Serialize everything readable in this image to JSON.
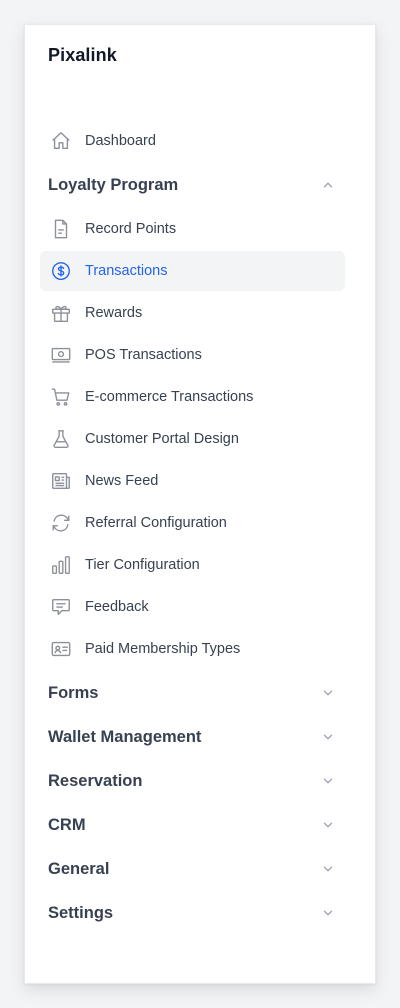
{
  "brand": "Pixalink",
  "nav": {
    "dashboard": "Dashboard",
    "loyalty_program": "Loyalty Program",
    "loyalty_items": [
      {
        "label": "Record Points",
        "icon": "document-icon"
      },
      {
        "label": "Transactions",
        "icon": "dollar-circle-icon",
        "active": true
      },
      {
        "label": "Rewards",
        "icon": "gift-icon"
      },
      {
        "label": "POS Transactions",
        "icon": "cash-icon"
      },
      {
        "label": "E-commerce Transactions",
        "icon": "cart-icon"
      },
      {
        "label": "Customer Portal Design",
        "icon": "beaker-icon"
      },
      {
        "label": "News Feed",
        "icon": "newspaper-icon"
      },
      {
        "label": "Referral Configuration",
        "icon": "refresh-icon"
      },
      {
        "label": "Tier Configuration",
        "icon": "bar-chart-icon"
      },
      {
        "label": "Feedback",
        "icon": "chat-icon"
      },
      {
        "label": "Paid Membership Types",
        "icon": "id-card-icon"
      }
    ],
    "sections": [
      {
        "label": "Forms"
      },
      {
        "label": "Wallet Management"
      },
      {
        "label": "Reservation"
      },
      {
        "label": "CRM"
      },
      {
        "label": "General"
      },
      {
        "label": "Settings"
      }
    ]
  },
  "colors": {
    "accent": "#2563eb",
    "active_bg": "#f3f4f6",
    "text": "#374151",
    "icon": "#8b9099"
  }
}
